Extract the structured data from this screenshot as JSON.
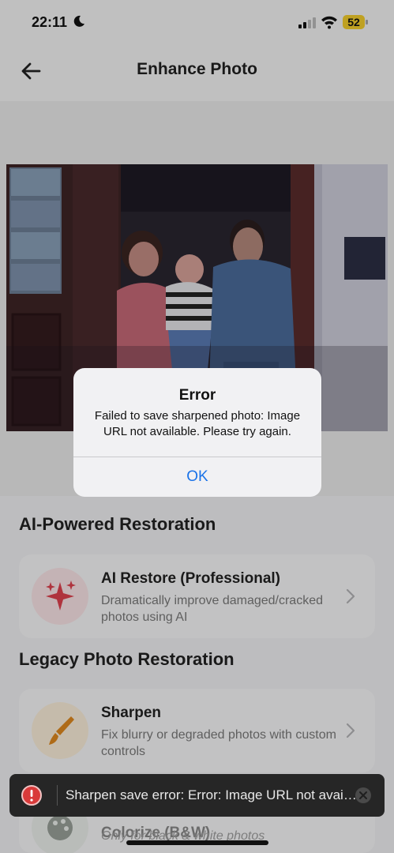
{
  "status_bar": {
    "time": "22:11",
    "battery": "52"
  },
  "header": {
    "title": "Enhance Photo",
    "back_icon": "back-arrow-icon"
  },
  "sections": [
    {
      "title": "AI-Powered Restoration",
      "cards": [
        {
          "title": "AI Restore (Professional)",
          "description": "Dramatically improve damaged/cracked photos using AI",
          "icon": "sparkles-icon",
          "accent": "#e0424f"
        }
      ]
    },
    {
      "title": "Legacy Photo Restoration",
      "cards": [
        {
          "title": "Sharpen",
          "description": "Fix blurry or degraded photos with custom controls",
          "icon": "brush-icon",
          "accent": "#e08a1e"
        },
        {
          "title": "Colorize (B&W)",
          "description": "Only for black & white photos",
          "icon": "palette-icon",
          "accent": "#9aa29a"
        }
      ]
    }
  ],
  "alert": {
    "title": "Error",
    "message": "Failed to save sharpened photo: Image URL not available. Please try again.",
    "ok_label": "OK"
  },
  "toast": {
    "text": "Sharpen save error: Error: Image URL not available. Please try again.",
    "icon": "error-icon",
    "close_icon": "close-icon"
  },
  "colors": {
    "accent_blue": "#1a73e8",
    "error_red": "#d93a3a"
  }
}
